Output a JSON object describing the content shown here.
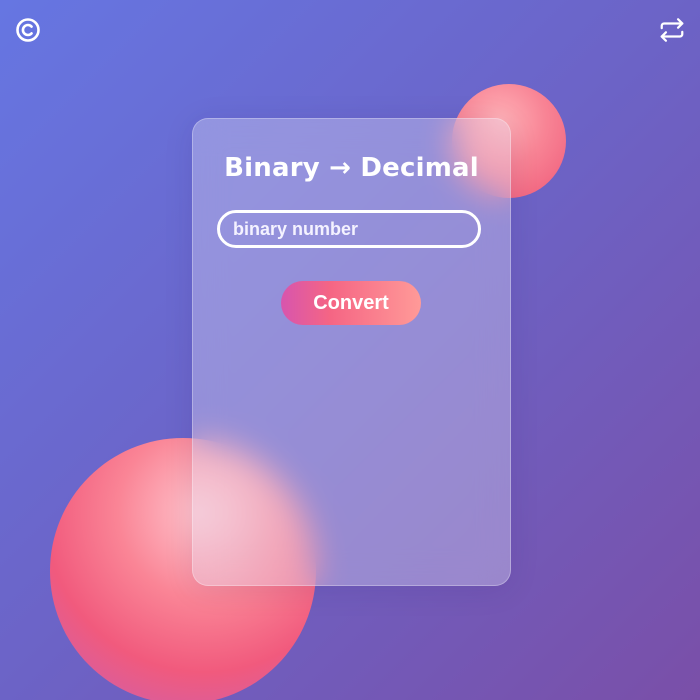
{
  "icons": {
    "top_left": "copyright-icon",
    "top_right": "swap-arrows-icon"
  },
  "card": {
    "title": "Binary → Decimal",
    "input_placeholder": "binary number",
    "input_value": "",
    "convert_label": "Convert"
  },
  "colors": {
    "background_start": "#6676e2",
    "background_end": "#7a4fa8",
    "orb": "#f15a7d",
    "button_start": "#d755ae",
    "button_end": "#ff9a98",
    "text": "#ffffff"
  }
}
